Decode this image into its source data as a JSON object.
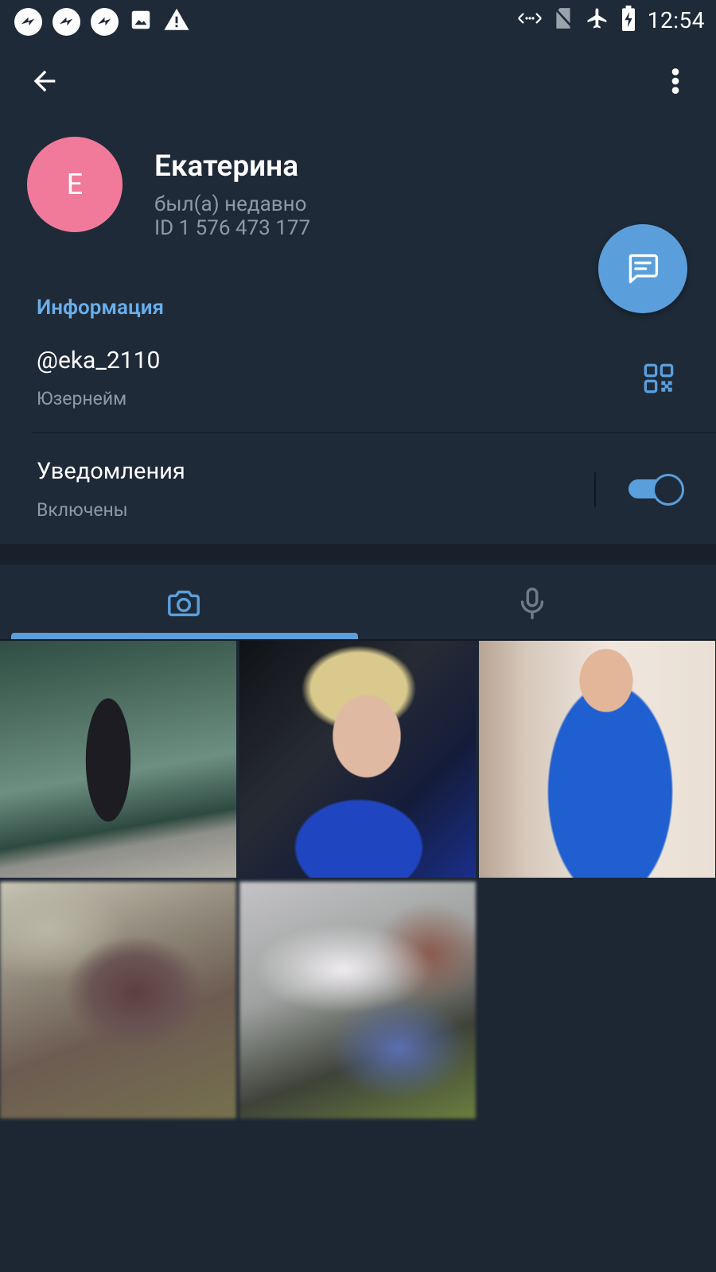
{
  "status_bar": {
    "time": "12:54",
    "left_icons": [
      "app-notification-icon",
      "app-notification-icon",
      "app-notification-icon",
      "image-icon",
      "warning-icon"
    ],
    "right_icons": [
      "data-saver-icon",
      "no-sim-icon",
      "airplane-mode-icon",
      "battery-charging-icon"
    ]
  },
  "header": {
    "back_icon": "arrow-back-icon",
    "menu_icon": "more-vert-icon",
    "avatar_letter": "E",
    "avatar_color": "#f17a9a",
    "name": "Екатерина",
    "status": "был(а) недавно",
    "user_id": "ID 1 576 473 177"
  },
  "fab": {
    "icon": "message-icon",
    "color": "#5a9fdc"
  },
  "info": {
    "heading": "Информация",
    "username": "@eka_2110",
    "username_label": "Юзернейм",
    "qr_icon": "qr-code-icon",
    "notifications_title": "Уведомления",
    "notifications_status": "Включены",
    "notifications_enabled": true
  },
  "tabs": [
    {
      "icon": "camera-icon",
      "selected": true
    },
    {
      "icon": "microphone-icon",
      "selected": false
    }
  ],
  "accent_color": "#5a9fdc",
  "media_count": 5
}
